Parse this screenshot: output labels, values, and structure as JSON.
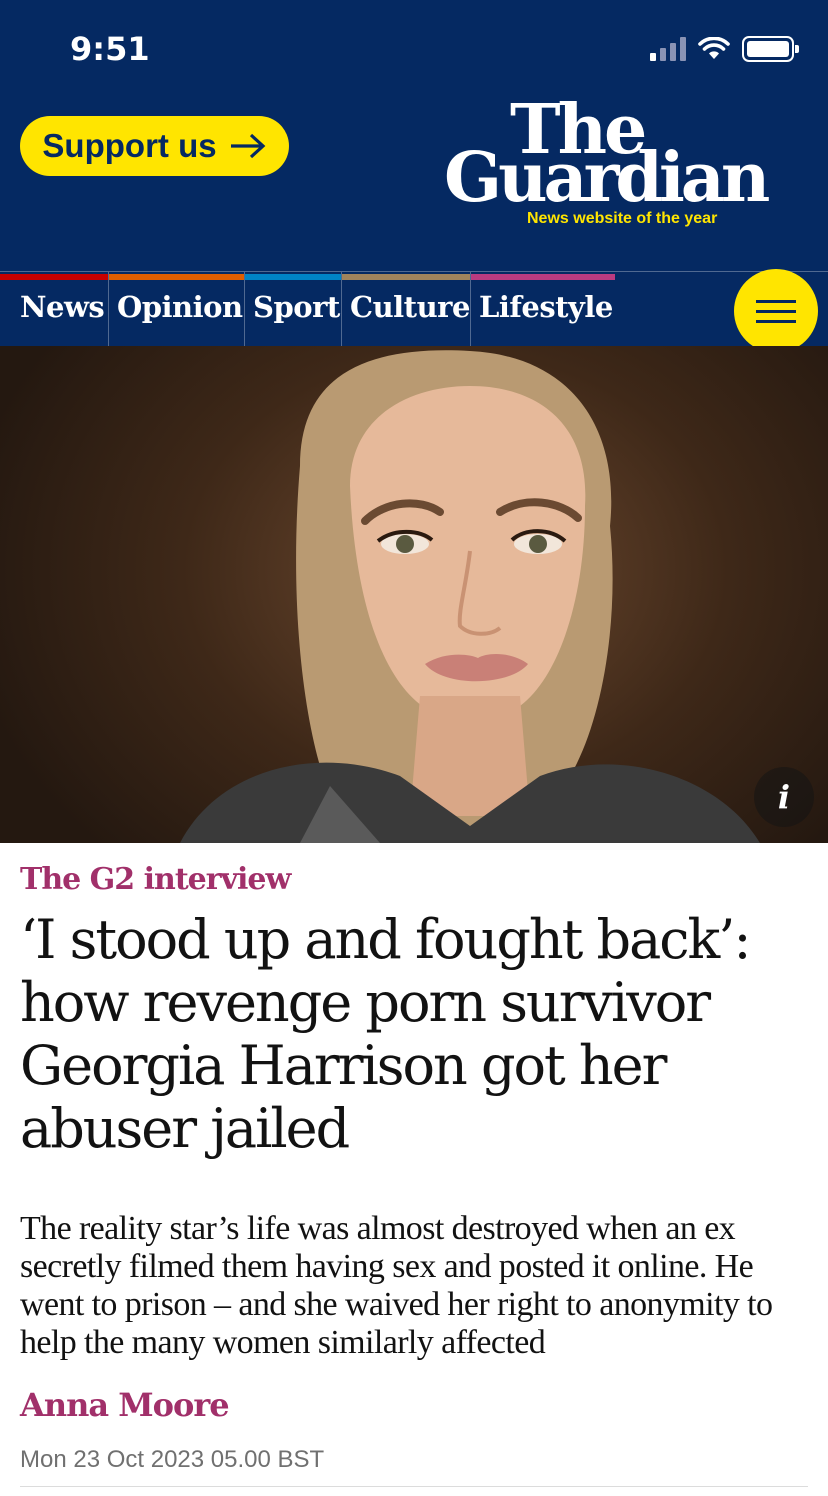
{
  "status_bar": {
    "time": "9:51"
  },
  "header": {
    "support_label": "Support us",
    "logo_line1": "The",
    "logo_line2": "Guardian",
    "logo_tagline": "News website of the year"
  },
  "nav": {
    "items": [
      {
        "label": "News",
        "color": "#c70000"
      },
      {
        "label": "Opinion",
        "color": "#e05e00"
      },
      {
        "label": "Sport",
        "color": "#0084c6"
      },
      {
        "label": "Culture",
        "color": "#a1845c"
      },
      {
        "label": "Lifestyle",
        "color": "#bb3b80"
      }
    ]
  },
  "hero": {
    "info_label": "i",
    "icon": "info-icon"
  },
  "article": {
    "kicker": "The G2 interview",
    "headline": "‘I stood up and fought back’: how revenge porn survivor Georgia Harrison got her abuser jailed",
    "standfirst": "The reality star’s life was almost destroyed when an ex secretly filmed them having sex and posted it online. He went to prison – and she waived her right to anonymity to help the many women similarly affected",
    "byline": "Anna Moore",
    "date": "Mon 23 Oct 2023 05.00 BST"
  },
  "colors": {
    "brand": "#052962",
    "accent_yellow": "#ffe500",
    "kicker": "#a1306a"
  }
}
